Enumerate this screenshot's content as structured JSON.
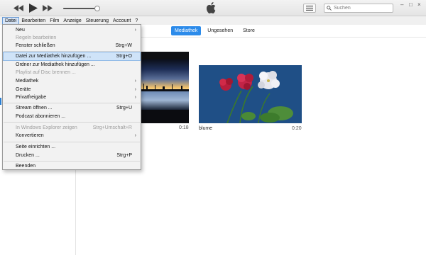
{
  "toolbar": {
    "prev_icon": "rewind-icon",
    "play_icon": "play-icon",
    "next_icon": "fast-forward-icon",
    "volume_level": 0.95,
    "brand_icon": "apple-logo-icon",
    "list_icon": "list-view-icon",
    "search": {
      "placeholder": "Suchen",
      "value": "",
      "icon": "search-icon"
    },
    "window_controls": {
      "minimize": "–",
      "maximize": "□",
      "close": "×"
    }
  },
  "menubar": {
    "items": [
      {
        "label": "Datei",
        "active": true
      },
      {
        "label": "Bearbeiten"
      },
      {
        "label": "Film"
      },
      {
        "label": "Anzeige"
      },
      {
        "label": "Steuerung"
      },
      {
        "label": "Account"
      },
      {
        "label": "?"
      }
    ]
  },
  "tabs": [
    {
      "label": "Mediathek",
      "selected": true
    },
    {
      "label": "Ungesehen"
    },
    {
      "label": "Store"
    }
  ],
  "media": [
    {
      "title": "",
      "duration": "0:18"
    },
    {
      "title": "blume",
      "duration": "0:20"
    }
  ],
  "file_menu": {
    "items": [
      {
        "label": "Neu",
        "submenu": true
      },
      {
        "label": "Regeln bearbeiten",
        "disabled": true
      },
      {
        "label": "Fenster schließen",
        "shortcut": "Strg+W"
      },
      {
        "separator": true
      },
      {
        "label": "Datei zur Mediathek hinzufügen ...",
        "shortcut": "Strg+O",
        "highlighted": true
      },
      {
        "label": "Ordner zur Mediathek hinzufügen ..."
      },
      {
        "label": "Playlist auf Disc brennen ...",
        "disabled": true
      },
      {
        "label": "Mediathek",
        "submenu": true
      },
      {
        "label": "Geräte",
        "submenu": true
      },
      {
        "label": "Privatfreigabe",
        "submenu": true
      },
      {
        "separator": true
      },
      {
        "label": "Stream öffnen ...",
        "shortcut": "Strg+U"
      },
      {
        "label": "Podcast abonnieren ..."
      },
      {
        "separator": true
      },
      {
        "label": "In Windows Explorer zeigen",
        "shortcut": "Strg+Umschalt+R",
        "disabled": true
      },
      {
        "label": "Konvertieren",
        "submenu": true
      },
      {
        "separator": true
      },
      {
        "label": "Seite einrichten ..."
      },
      {
        "label": "Drucken ...",
        "shortcut": "Strg+P"
      },
      {
        "separator": true
      },
      {
        "label": "Beenden"
      }
    ]
  },
  "colors": {
    "accent": "#2c8bea",
    "highlight": "#cfe3f8",
    "menu_bg": "#f2f2f2"
  }
}
